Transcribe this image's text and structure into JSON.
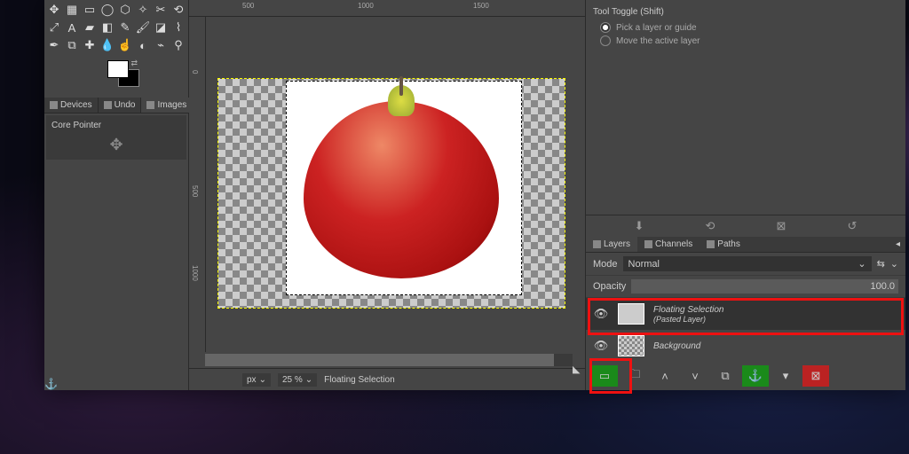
{
  "toolbox": {
    "tabs": {
      "devices": "Devices",
      "undo": "Undo",
      "images": "Images"
    },
    "device_label": "Core Pointer"
  },
  "canvas": {
    "ruler_marks_h": [
      "500",
      "1000",
      "1500"
    ],
    "ruler_marks_v": [
      "0",
      "500",
      "1000"
    ]
  },
  "status": {
    "unit": "px",
    "zoom": "25 %",
    "selection": "Floating Selection"
  },
  "tool_options": {
    "title": "Tool Toggle  (Shift)",
    "opt1": "Pick a layer or guide",
    "opt2": "Move the active layer"
  },
  "layers": {
    "tabs": {
      "layers": "Layers",
      "channels": "Channels",
      "paths": "Paths"
    },
    "mode_label": "Mode",
    "mode_value": "Normal",
    "opacity_label": "Opacity",
    "opacity_value": "100.0",
    "layer1": {
      "name": "Floating Selection",
      "sub": "(Pasted Layer)"
    },
    "layer2": {
      "name": "Background"
    }
  }
}
